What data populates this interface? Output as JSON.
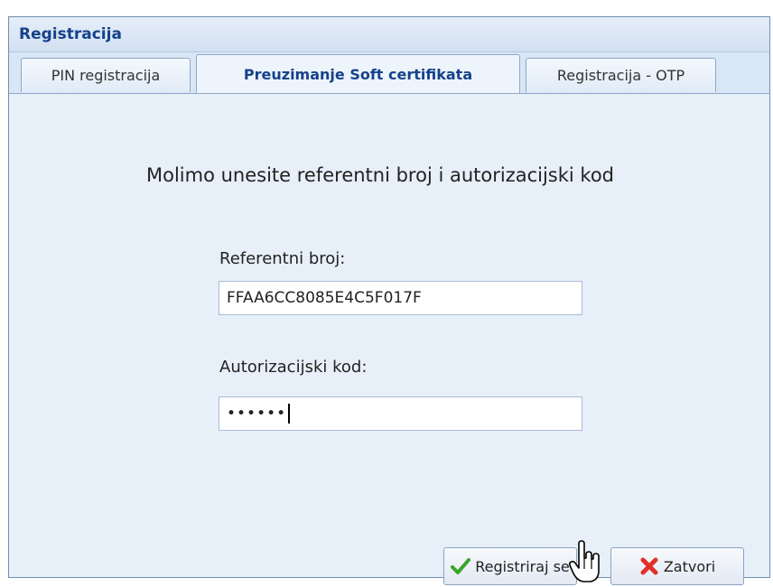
{
  "window": {
    "title": "Registracija"
  },
  "tabs": [
    {
      "label": "PIN registracija",
      "active": false
    },
    {
      "label": "Preuzimanje Soft certifikata",
      "active": true
    },
    {
      "label": "Registracija - OTP",
      "active": false
    }
  ],
  "panel": {
    "message": "Molimo unesite referentni broj i autorizacijski kod",
    "reference": {
      "label": "Referentni broj:",
      "value": "FFAA6CC8085E4C5F017F"
    },
    "auth_code": {
      "label": "Autorizacijski kod:",
      "masked_value": "••••••"
    }
  },
  "buttons": {
    "register": {
      "label": "Registriraj se",
      "icon": "checkmark-icon",
      "icon_color": "#3aa52b"
    },
    "close": {
      "label": "Zatvori",
      "icon": "red-x-icon",
      "icon_color": "#e0312a"
    }
  },
  "colors": {
    "title": "#15428b",
    "panel_bg": "#e7eff9",
    "border": "#8fa8c9"
  }
}
